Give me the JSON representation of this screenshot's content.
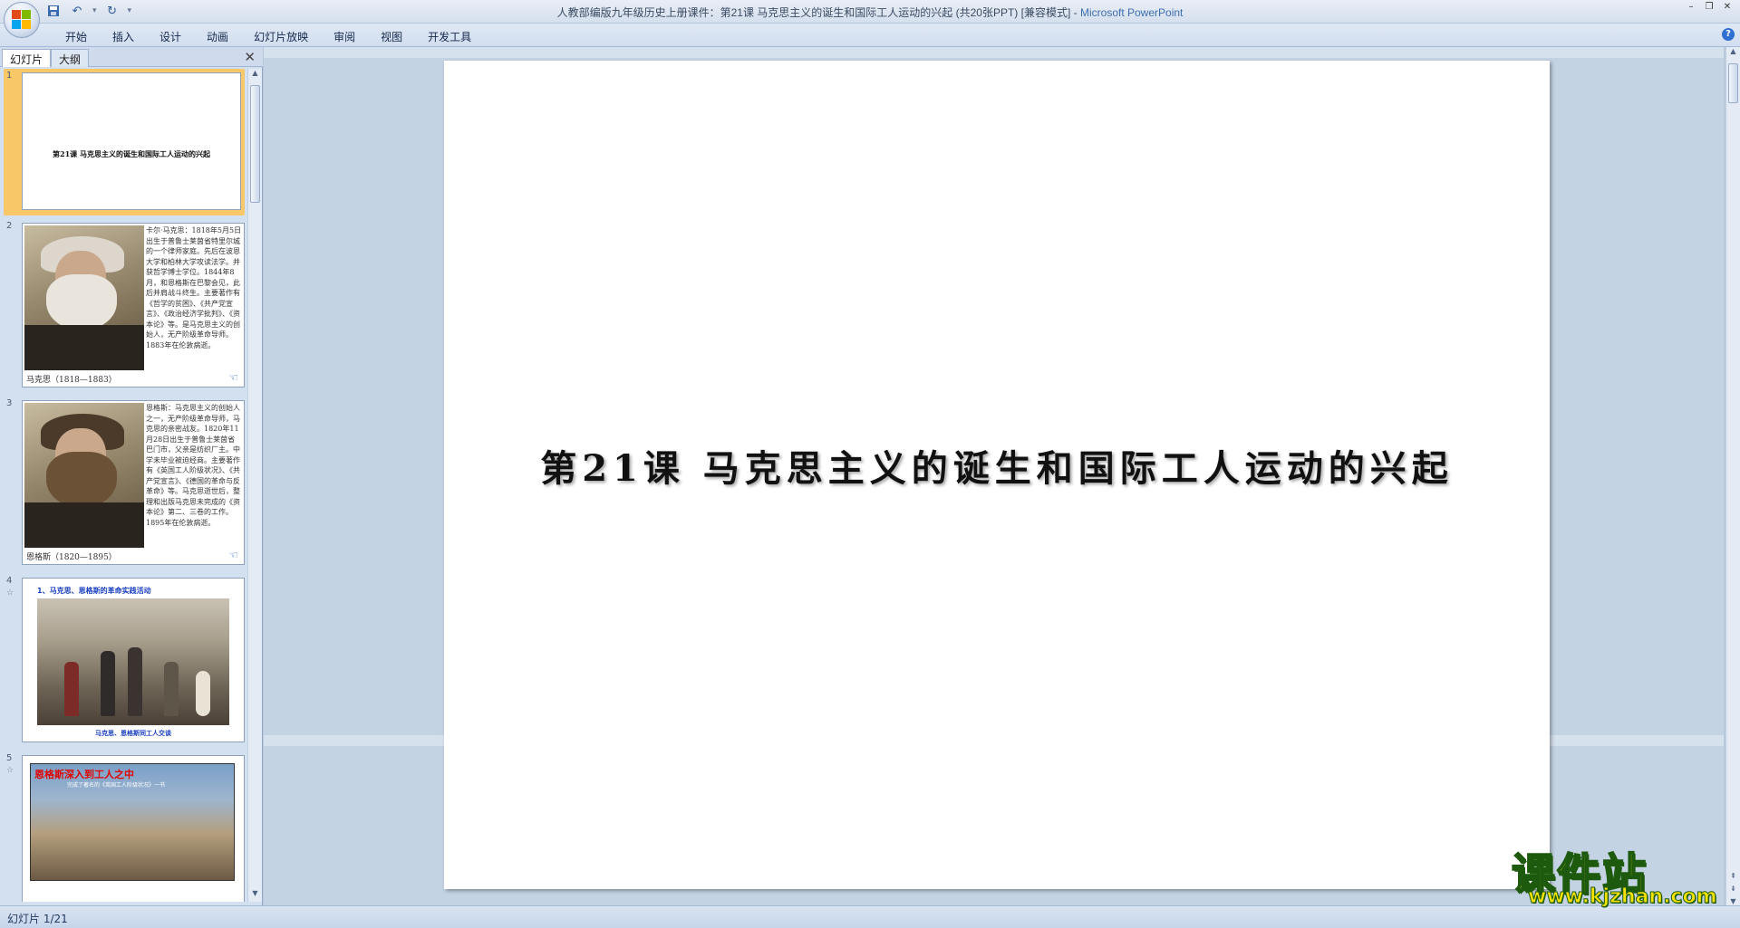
{
  "window": {
    "title": "人教部编版九年级历史上册课件：第21课  马克思主义的诞生和国际工人运动的兴起 (共20张PPT) [兼容模式]",
    "app_name": "Microsoft PowerPoint"
  },
  "ribbon": {
    "tabs": [
      "开始",
      "插入",
      "设计",
      "动画",
      "幻灯片放映",
      "审阅",
      "视图",
      "开发工具"
    ]
  },
  "left_panel": {
    "tab_slides": "幻灯片",
    "tab_outline": "大纲",
    "close_glyph": "✕",
    "slides": [
      {
        "num": "1",
        "title": "第21课  马克思主义的诞生和国际工人运动的兴起"
      },
      {
        "num": "2",
        "caption": "马克思（1818—1883）",
        "bio": "卡尔·马克思：1818年5月5日出生于普鲁士莱茵省特里尔城的一个律师家庭。先后在波恩大学和柏林大学攻读法学。并获哲学博士学位。1844年8月，和恩格斯在巴黎会见，此后并肩战斗终生。主要著作有《哲学的贫困》、《共产党宣言》、《政治经济学批判》、《资本论》等。是马克思主义的创始人，无产阶级革命导师。1883年在伦敦病逝。"
      },
      {
        "num": "3",
        "caption": "恩格斯（1820—1895）",
        "bio": "恩格斯：马克思主义的创始人之一，无产阶级革命导师，马克思的亲密战友。1820年11月28日出生于普鲁士莱茵省巴门市，父亲是纺织厂主。中学未毕业被迫经商。主要著作有《英国工人阶级状况》、《共产党宣言》、《德国的革命与反革命》等。马克思逝世后，整理和出版马克思未完成的《资本论》第二、三卷的工作。1895年在伦敦病逝。"
      },
      {
        "num": "4",
        "heading": "1、马克思、恩格斯的革命实践活动",
        "caption": "马克思、恩格斯同工人交谈"
      },
      {
        "num": "5",
        "heading": "恩格斯深入到工人之中",
        "sub": "完成了著名的《英国工人阶级状况》一书"
      }
    ]
  },
  "slide": {
    "title": "第21课   马克思主义的诞生和国际工人运动的兴起"
  },
  "status": {
    "slide_indicator": "幻灯片 1/21"
  },
  "watermark": {
    "name": "课件站",
    "url": "www.kjzhan.com"
  },
  "colors": {
    "accent": "#3d6fae",
    "selection": "#f7c768",
    "watermark_fill": "#f6e300",
    "watermark_stroke": "#1e5a0e"
  }
}
